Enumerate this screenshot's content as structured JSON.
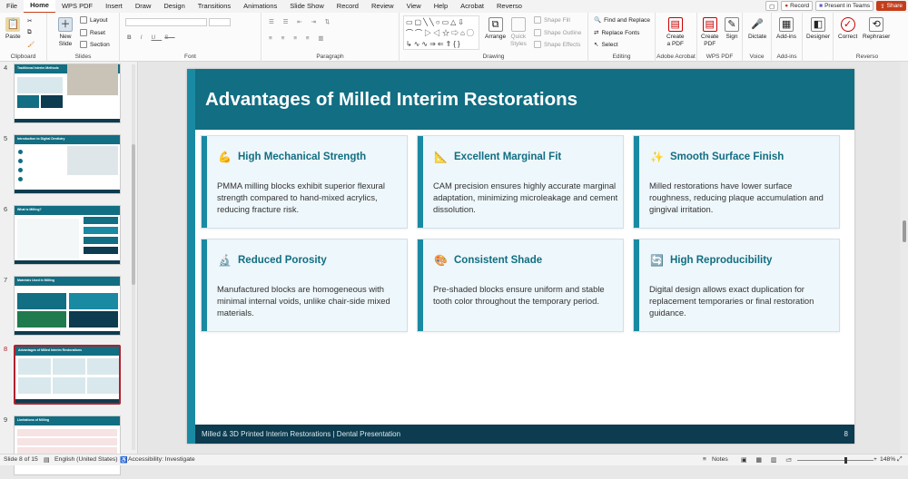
{
  "menu": [
    "File",
    "Home",
    "WPS PDF",
    "Insert",
    "Draw",
    "Design",
    "Transitions",
    "Animations",
    "Slide Show",
    "Record",
    "Review",
    "View",
    "Help",
    "Acrobat",
    "Reverso"
  ],
  "topright": {
    "record": "Record",
    "present": "Present in Teams",
    "share": "Share"
  },
  "ribbon": {
    "clipboard": {
      "label": "Clipboard",
      "paste": "Paste"
    },
    "slides": {
      "label": "Slides",
      "new_slide": "New",
      "new_slide2": "Slide",
      "layout": "Layout",
      "reset": "Reset",
      "section": "Section"
    },
    "font": {
      "label": "Font"
    },
    "paragraph": {
      "label": "Paragraph"
    },
    "drawing": {
      "label": "Drawing",
      "arrange": "Arrange",
      "quick_styles": "Quick",
      "quick_styles2": "Styles",
      "shape_fill": "Shape Fill",
      "shape_outline": "Shape Outline",
      "shape_effects": "Shape Effects"
    },
    "editing": {
      "label": "Editing",
      "find_replace": "Find and Replace",
      "replace_fonts": "Replace Fonts",
      "select": "Select"
    },
    "acrobat": {
      "label": "Adobe Acrobat",
      "create_pdf": "Create",
      "create_pdf2": "a PDF"
    },
    "wps": {
      "label": "WPS PDF",
      "create_pdf": "Create",
      "create_pdf2": "PDF",
      "sign": "Sign"
    },
    "voice": {
      "label": "Voice",
      "dictate": "Dictate"
    },
    "addins": {
      "label": "Add-ins",
      "addins": "Add-ins"
    },
    "designer": {
      "designer": "Designer"
    },
    "reverso": {
      "label": "Reverso",
      "correct": "Correct",
      "rephraser": "Rephraser"
    }
  },
  "thumbnails": [
    {
      "num": "4",
      "title": "Traditional Interim Methods"
    },
    {
      "num": "5",
      "title": "Introduction to Digital Dentistry"
    },
    {
      "num": "6",
      "title": "What is Milling?"
    },
    {
      "num": "7",
      "title": "Materials Used in Milling"
    },
    {
      "num": "8",
      "title": "Advantages of Milled Interim Restorations"
    },
    {
      "num": "9",
      "title": "Limitations of Milling"
    }
  ],
  "slide": {
    "title": "Advantages of Milled Interim Restorations",
    "cards": [
      {
        "icon": "💪",
        "title": "High Mechanical Strength",
        "body": "PMMA milling blocks exhibit superior flexural strength compared to hand-mixed acrylics, reducing fracture risk."
      },
      {
        "icon": "📐",
        "title": "Excellent Marginal Fit",
        "body": "CAM precision ensures highly accurate marginal adaptation, minimizing microleakage and cement dissolution."
      },
      {
        "icon": "✨",
        "title": "Smooth Surface Finish",
        "body": "Milled restorations have lower surface roughness, reducing plaque accumulation and gingival irritation."
      },
      {
        "icon": "🔬",
        "title": "Reduced Porosity",
        "body": "Manufactured blocks are homogeneous with minimal internal voids, unlike chair-side mixed materials."
      },
      {
        "icon": "🎨",
        "title": "Consistent Shade",
        "body": "Pre-shaded blocks ensure uniform and stable tooth color throughout the temporary period."
      },
      {
        "icon": "🔄",
        "title": "High Reproducibility",
        "body": "Digital design allows exact duplication for replacement temporaries or final restoration guidance."
      }
    ],
    "footer": "Milled & 3D Printed Interim Restorations  |  Dental Presentation",
    "number": "8"
  },
  "status": {
    "slide": "Slide 8 of 15",
    "language": "English (United States)",
    "accessibility": "Accessibility: Investigate",
    "notes": "Notes",
    "zoom": "148%"
  },
  "colors": {
    "accent": "#1a8aa3",
    "header": "#126e82",
    "footer": "#0d3b4f",
    "selected_thumb": "#b0212e",
    "share": "#c43e1c"
  }
}
